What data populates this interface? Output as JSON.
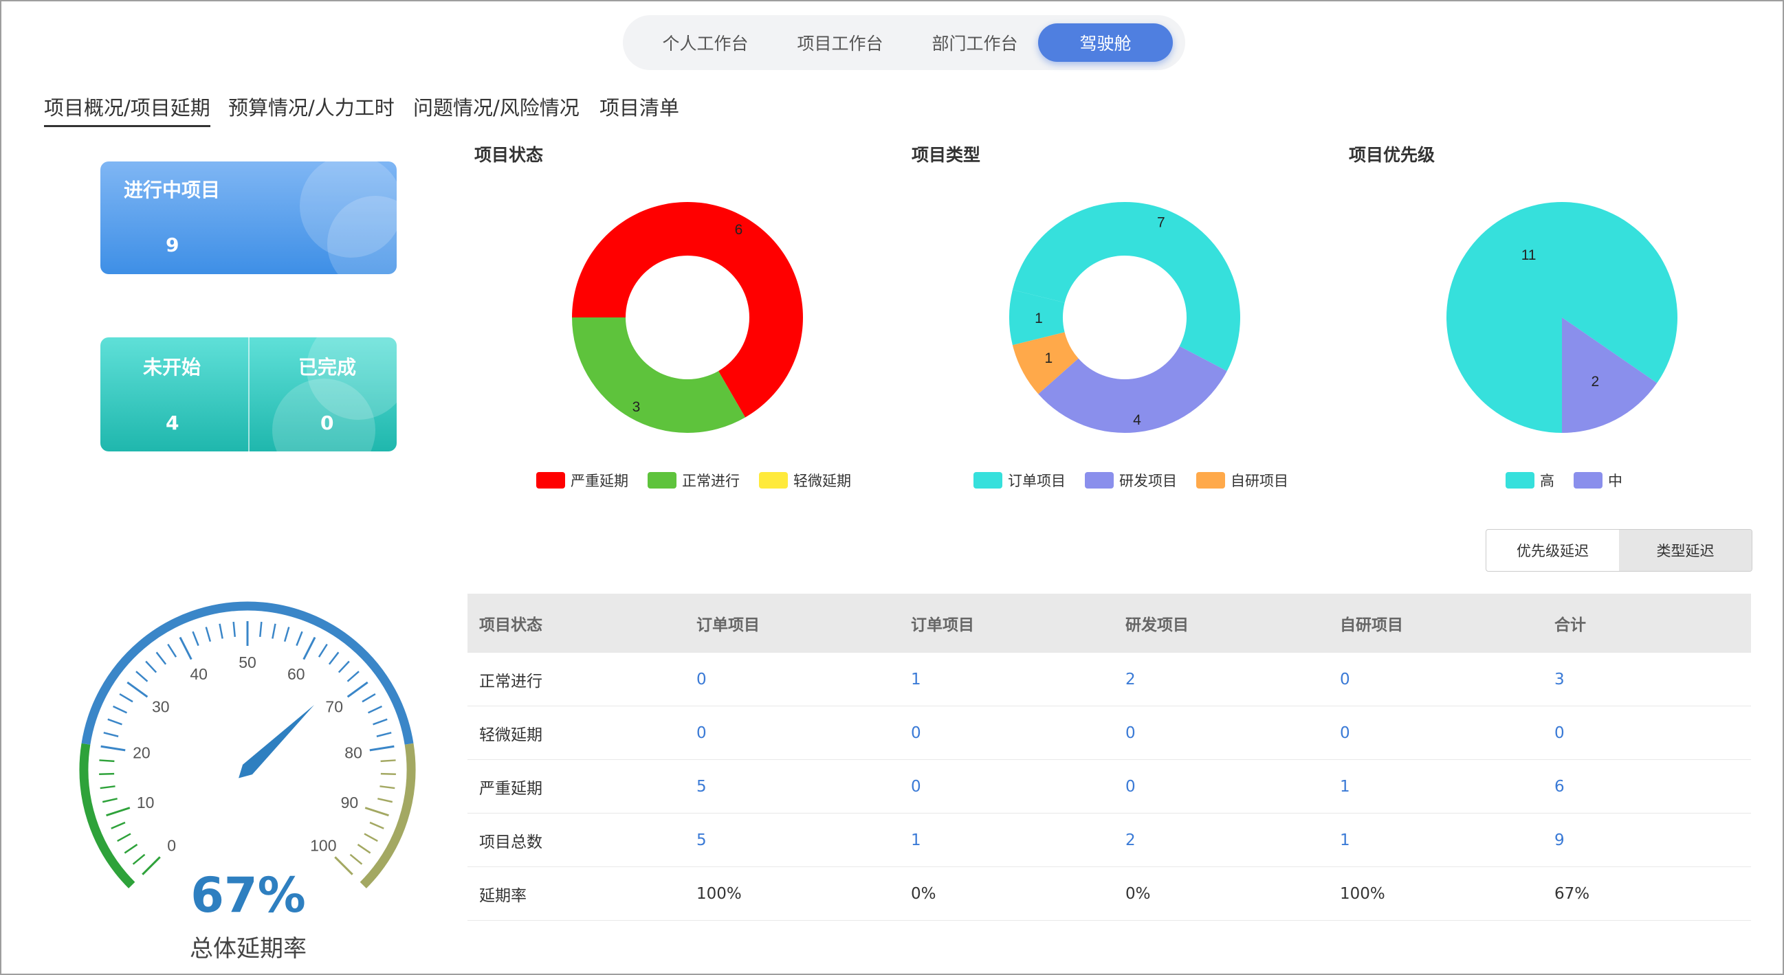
{
  "top_nav": {
    "tabs": [
      "个人工作台",
      "项目工作台",
      "部门工作台",
      "驾驶舱"
    ],
    "active_index": 3
  },
  "sub_tabs": [
    "项目概况/项目延期",
    "预算情况/人力工时",
    "问题情况/风险情况",
    "项目清单"
  ],
  "cards": {
    "in_progress": {
      "label": "进行中项目",
      "value": "9"
    },
    "not_started": {
      "label": "未开始",
      "value": "4"
    },
    "completed": {
      "label": "已完成",
      "value": "0"
    }
  },
  "chart_titles": {
    "status": "项目状态",
    "type": "项目类型",
    "priority": "项目优先级"
  },
  "chart_data": [
    {
      "type": "pie",
      "title": "项目状态",
      "donut": true,
      "slices": [
        {
          "name": "严重延期",
          "value": 6,
          "color": "#ff0000"
        },
        {
          "name": "正常进行",
          "value": 3,
          "color": "#5ec33c"
        },
        {
          "name": "轻微延期",
          "value": 0,
          "color": "#ffea3b"
        }
      ],
      "legend": "bottom"
    },
    {
      "type": "pie",
      "title": "项目类型",
      "donut": true,
      "slices": [
        {
          "name": "订单项目",
          "value": 7,
          "color": "#36e0dc"
        },
        {
          "name": "研发项目",
          "value": 4,
          "color": "#8a8fec"
        },
        {
          "name": "自研项目",
          "value": 1,
          "color": "#ffa94a"
        },
        {
          "name": "订单项目",
          "value": 1,
          "color": "#36e0dc"
        }
      ],
      "legend_entries": [
        {
          "name": "订单项目",
          "color": "#36e0dc"
        },
        {
          "name": "研发项目",
          "color": "#8a8fec"
        },
        {
          "name": "自研项目",
          "color": "#ffa94a"
        }
      ],
      "legend": "bottom"
    },
    {
      "type": "pie",
      "title": "项目优先级",
      "donut": false,
      "slices": [
        {
          "name": "高",
          "value": 11,
          "color": "#36e0dc"
        },
        {
          "name": "中",
          "value": 2,
          "color": "#8a8fec"
        }
      ],
      "legend": "bottom"
    },
    {
      "type": "gauge",
      "value": 67,
      "min": 0,
      "max": 100,
      "major_ticks": [
        0,
        10,
        20,
        30,
        40,
        50,
        60,
        70,
        80,
        90,
        100
      ],
      "value_label": "67%",
      "label": "总体延期率"
    }
  ],
  "toggle": {
    "options": [
      "优先级延迟",
      "类型延迟"
    ],
    "selected_index": 1
  },
  "table": {
    "headers": [
      "项目状态",
      "订单项目",
      "订单项目",
      "研发项目",
      "自研项目",
      "合计"
    ],
    "rows": [
      [
        "正常进行",
        "0",
        "1",
        "2",
        "0",
        "3"
      ],
      [
        "轻微延期",
        "0",
        "0",
        "0",
        "0",
        "0"
      ],
      [
        "严重延期",
        "5",
        "0",
        "0",
        "1",
        "6"
      ],
      [
        "项目总数",
        "5",
        "1",
        "2",
        "1",
        "9"
      ],
      [
        "延期率",
        "100%",
        "0%",
        "0%",
        "100%",
        "67%"
      ]
    ]
  },
  "gauge": {
    "value_text": "67%",
    "label": "总体延期率"
  }
}
